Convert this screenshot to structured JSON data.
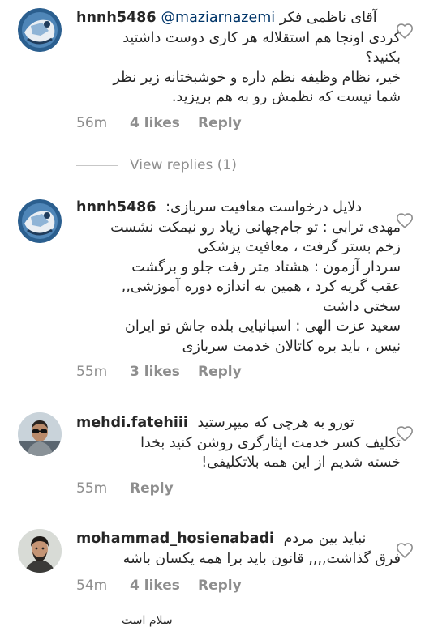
{
  "comments": [
    {
      "username": "hnnh5486",
      "mention": "@maziarnazemi",
      "first_line_text": "آقای ناظمی فکر",
      "lines": [
        "کردی اونجا هم استقلاله هر کاری دوست داشتید",
        "بکنید؟",
        "خیر، نظام وظیفه نظم داره و خوشبختانه زیر نظر",
        "شما نیست که نظمش رو به هم بریزید."
      ],
      "time": "56m",
      "likes": "4 likes",
      "reply": "Reply",
      "avatar_icon": "blue-graphic-avatar",
      "view_replies": "View replies (1)"
    },
    {
      "username": "hnnh5486",
      "first_line_text": "دلایل درخواست معافیت سربازی:",
      "lines": [
        "مهدی ترابی : تو جام‌جهانی زیاد رو نیمکت نشست",
        "زخم بستر گرفت ، معافیت پزشکی",
        "سردار آزمون : هشتاد متر رفت جلو و برگشت",
        "عقب گریه کرد ، همین به اندازه دوره آموزشی,,",
        "سختی داشت",
        "سعید عزت الهی : اسپانیایی بلده جاش تو ایران",
        "نیس ، باید بره کاتالان خدمت سربازی"
      ],
      "time": "55m",
      "likes": "3 likes",
      "reply": "Reply",
      "avatar_icon": "blue-graphic-avatar"
    },
    {
      "username": "mehdi.fatehiii",
      "first_line_text": "تورو به هرچی که میپرستید",
      "lines": [
        "تکلیف کسر خدمت ایثارگری روشن کنید بخدا",
        "خسته شدیم از این همه بلاتکلیفی!"
      ],
      "time": "55m",
      "likes": "",
      "reply": "Reply",
      "avatar_icon": "man-sunglasses-avatar"
    },
    {
      "username": "mohammad_hosienabadi",
      "first_line_text": "نباید بین مردم",
      "lines": [
        "فرق گذاشت,,,, قانون باید برا همه یکسان باشه"
      ],
      "time": "54m",
      "likes": "4 likes",
      "reply": "Reply",
      "avatar_icon": "man-beard-avatar"
    }
  ],
  "partial_text": "ﺳﻼﻡ ﺍﺳﺖ"
}
